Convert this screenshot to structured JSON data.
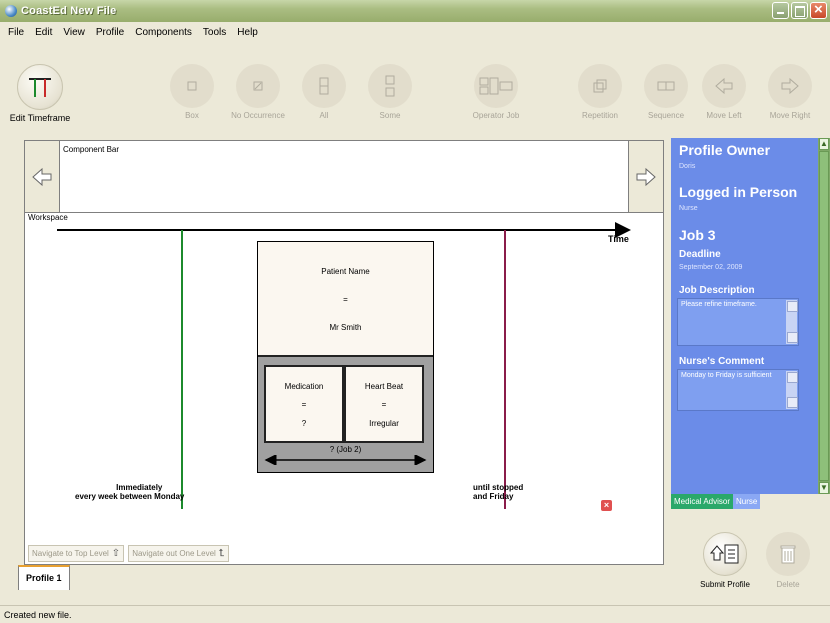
{
  "window": {
    "title": "CoastEd   New File"
  },
  "menu": [
    "File",
    "Edit",
    "View",
    "Profile",
    "Components",
    "Tools",
    "Help"
  ],
  "toolbar": {
    "edit_timeframe": "Edit Timeframe",
    "box": "Box",
    "no_occurrence": "No Occurrence",
    "all": "All",
    "some": "Some",
    "operator_job": "Operator Job",
    "repetition": "Repetition",
    "sequence": "Sequence",
    "move_left": "Move Left",
    "move_right": "Move Right"
  },
  "component_bar": {
    "caption": "Component Bar"
  },
  "workspace": {
    "caption": "Workspace",
    "time_label": "Time",
    "job": {
      "top": {
        "name": "Patient Name",
        "op": "=",
        "value": "Mr Smith"
      },
      "left": {
        "name": "Medication",
        "op": "=",
        "value": "?"
      },
      "right": {
        "name": "Heart Beat",
        "op": "=",
        "value": "Irregular"
      },
      "arrow_label": "? (Job 2)"
    },
    "start_annotation": {
      "line1": "Immediately",
      "line2": "every week between Monday"
    },
    "end_annotation": {
      "line1": "until stopped",
      "line2": "and Friday"
    },
    "colors": {
      "start_line": "#1c8a2c",
      "end_line": "#8a1c4a"
    }
  },
  "navigation": {
    "top_level": "Navigate to Top Level",
    "out_one_level": "Navigate out One Level"
  },
  "tabs": [
    "Profile 1"
  ],
  "side_panel": {
    "profile_owner_label": "Profile Owner",
    "profile_owner": "Doris",
    "logged_in_label": "Logged in Person",
    "logged_in": "Nurse",
    "job_title": "Job 3",
    "deadline_label": "Deadline",
    "deadline": "September 02, 2009",
    "job_description_label": "Job Description",
    "job_description": "Please refine timeframe.",
    "nurse_comment_label": "Nurse's Comment",
    "nurse_comment": "Monday to Friday is sufficient",
    "tabs": [
      "Medical Advisor",
      "Nurse"
    ],
    "accent": "#6b8ce8"
  },
  "actions": {
    "submit": "Submit Profile",
    "delete": "Delete"
  },
  "status": {
    "text": "Created new file."
  }
}
